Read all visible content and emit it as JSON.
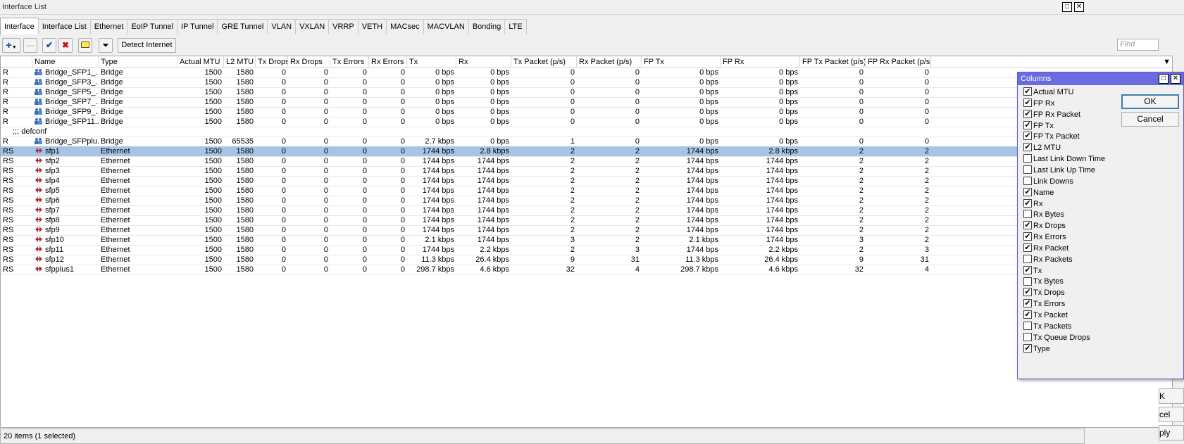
{
  "window": {
    "title": "Interface List"
  },
  "tabs": [
    "Interface",
    "Interface List",
    "Ethernet",
    "EoIP Tunnel",
    "IP Tunnel",
    "GRE Tunnel",
    "VLAN",
    "VXLAN",
    "VRRP",
    "VETH",
    "MACsec",
    "MACVLAN",
    "Bonding",
    "LTE"
  ],
  "active_tab": "Interface",
  "toolbar": {
    "detect_label": "Detect Internet",
    "find_placeholder": "Find"
  },
  "columns": [
    "",
    "Name",
    "Type",
    "Actual MTU",
    "L2 MTU",
    "Tx Drops",
    "Rx Drops",
    "Tx Errors",
    "Rx Errors",
    "Tx",
    "Rx",
    "Tx Packet (p/s)",
    "Rx Packet (p/s)",
    "FP Tx",
    "FP Rx",
    "FP Tx Packet (p/s)",
    "FP Rx Packet (p/s)"
  ],
  "rows": [
    {
      "flag": "R",
      "name": "Bridge_SFP1_...",
      "type": "Bridge",
      "amtu": "1500",
      "l2mtu": "1580",
      "txd": "0",
      "rxd": "0",
      "txe": "0",
      "rxe": "0",
      "tx": "0 bps",
      "rx": "0 bps",
      "txp": "0",
      "rxp": "0",
      "fptx": "0 bps",
      "fprx": "0 bps",
      "fptxp": "0",
      "fprxp": "0",
      "icon": "bridge-icon"
    },
    {
      "flag": "R",
      "name": "Bridge_SFP3_...",
      "type": "Bridge",
      "amtu": "1500",
      "l2mtu": "1580",
      "txd": "0",
      "rxd": "0",
      "txe": "0",
      "rxe": "0",
      "tx": "0 bps",
      "rx": "0 bps",
      "txp": "0",
      "rxp": "0",
      "fptx": "0 bps",
      "fprx": "0 bps",
      "fptxp": "0",
      "fprxp": "0",
      "icon": "bridge-icon"
    },
    {
      "flag": "R",
      "name": "Bridge_SFP5_...",
      "type": "Bridge",
      "amtu": "1500",
      "l2mtu": "1580",
      "txd": "0",
      "rxd": "0",
      "txe": "0",
      "rxe": "0",
      "tx": "0 bps",
      "rx": "0 bps",
      "txp": "0",
      "rxp": "0",
      "fptx": "0 bps",
      "fprx": "0 bps",
      "fptxp": "0",
      "fprxp": "0",
      "icon": "bridge-icon"
    },
    {
      "flag": "R",
      "name": "Bridge_SFP7_...",
      "type": "Bridge",
      "amtu": "1500",
      "l2mtu": "1580",
      "txd": "0",
      "rxd": "0",
      "txe": "0",
      "rxe": "0",
      "tx": "0 bps",
      "rx": "0 bps",
      "txp": "0",
      "rxp": "0",
      "fptx": "0 bps",
      "fprx": "0 bps",
      "fptxp": "0",
      "fprxp": "0",
      "icon": "bridge-icon"
    },
    {
      "flag": "R",
      "name": "Bridge_SFP9_...",
      "type": "Bridge",
      "amtu": "1500",
      "l2mtu": "1580",
      "txd": "0",
      "rxd": "0",
      "txe": "0",
      "rxe": "0",
      "tx": "0 bps",
      "rx": "0 bps",
      "txp": "0",
      "rxp": "0",
      "fptx": "0 bps",
      "fprx": "0 bps",
      "fptxp": "0",
      "fprxp": "0",
      "icon": "bridge-icon"
    },
    {
      "flag": "R",
      "name": "Bridge_SFP11...",
      "type": "Bridge",
      "amtu": "1500",
      "l2mtu": "1580",
      "txd": "0",
      "rxd": "0",
      "txe": "0",
      "rxe": "0",
      "tx": "0 bps",
      "rx": "0 bps",
      "txp": "0",
      "rxp": "0",
      "fptx": "0 bps",
      "fprx": "0 bps",
      "fptxp": "0",
      "fprxp": "0",
      "icon": "bridge-icon"
    },
    {
      "comment": ";;; defconf"
    },
    {
      "flag": "R",
      "name": "Bridge_SFPplu...",
      "type": "Bridge",
      "amtu": "1500",
      "l2mtu": "65535",
      "txd": "0",
      "rxd": "0",
      "txe": "0",
      "rxe": "0",
      "tx": "2.7 kbps",
      "rx": "0 bps",
      "txp": "1",
      "rxp": "0",
      "fptx": "0 bps",
      "fprx": "0 bps",
      "fptxp": "0",
      "fprxp": "0",
      "icon": "bridge-icon"
    },
    {
      "flag": "RS",
      "name": "sfp1",
      "type": "Ethernet",
      "amtu": "1500",
      "l2mtu": "1580",
      "txd": "0",
      "rxd": "0",
      "txe": "0",
      "rxe": "0",
      "tx": "1744 bps",
      "rx": "2.8 kbps",
      "txp": "2",
      "rxp": "2",
      "fptx": "1744 bps",
      "fprx": "2.8 kbps",
      "fptxp": "2",
      "fprxp": "2",
      "icon": "ethernet-icon",
      "selected": true
    },
    {
      "flag": "RS",
      "name": "sfp2",
      "type": "Ethernet",
      "amtu": "1500",
      "l2mtu": "1580",
      "txd": "0",
      "rxd": "0",
      "txe": "0",
      "rxe": "0",
      "tx": "1744 bps",
      "rx": "1744 bps",
      "txp": "2",
      "rxp": "2",
      "fptx": "1744 bps",
      "fprx": "1744 bps",
      "fptxp": "2",
      "fprxp": "2",
      "icon": "ethernet-icon"
    },
    {
      "flag": "RS",
      "name": "sfp3",
      "type": "Ethernet",
      "amtu": "1500",
      "l2mtu": "1580",
      "txd": "0",
      "rxd": "0",
      "txe": "0",
      "rxe": "0",
      "tx": "1744 bps",
      "rx": "1744 bps",
      "txp": "2",
      "rxp": "2",
      "fptx": "1744 bps",
      "fprx": "1744 bps",
      "fptxp": "2",
      "fprxp": "2",
      "icon": "ethernet-icon"
    },
    {
      "flag": "RS",
      "name": "sfp4",
      "type": "Ethernet",
      "amtu": "1500",
      "l2mtu": "1580",
      "txd": "0",
      "rxd": "0",
      "txe": "0",
      "rxe": "0",
      "tx": "1744 bps",
      "rx": "1744 bps",
      "txp": "2",
      "rxp": "2",
      "fptx": "1744 bps",
      "fprx": "1744 bps",
      "fptxp": "2",
      "fprxp": "2",
      "icon": "ethernet-icon"
    },
    {
      "flag": "RS",
      "name": "sfp5",
      "type": "Ethernet",
      "amtu": "1500",
      "l2mtu": "1580",
      "txd": "0",
      "rxd": "0",
      "txe": "0",
      "rxe": "0",
      "tx": "1744 bps",
      "rx": "1744 bps",
      "txp": "2",
      "rxp": "2",
      "fptx": "1744 bps",
      "fprx": "1744 bps",
      "fptxp": "2",
      "fprxp": "2",
      "icon": "ethernet-icon"
    },
    {
      "flag": "RS",
      "name": "sfp6",
      "type": "Ethernet",
      "amtu": "1500",
      "l2mtu": "1580",
      "txd": "0",
      "rxd": "0",
      "txe": "0",
      "rxe": "0",
      "tx": "1744 bps",
      "rx": "1744 bps",
      "txp": "2",
      "rxp": "2",
      "fptx": "1744 bps",
      "fprx": "1744 bps",
      "fptxp": "2",
      "fprxp": "2",
      "icon": "ethernet-icon"
    },
    {
      "flag": "RS",
      "name": "sfp7",
      "type": "Ethernet",
      "amtu": "1500",
      "l2mtu": "1580",
      "txd": "0",
      "rxd": "0",
      "txe": "0",
      "rxe": "0",
      "tx": "1744 bps",
      "rx": "1744 bps",
      "txp": "2",
      "rxp": "2",
      "fptx": "1744 bps",
      "fprx": "1744 bps",
      "fptxp": "2",
      "fprxp": "2",
      "icon": "ethernet-icon"
    },
    {
      "flag": "RS",
      "name": "sfp8",
      "type": "Ethernet",
      "amtu": "1500",
      "l2mtu": "1580",
      "txd": "0",
      "rxd": "0",
      "txe": "0",
      "rxe": "0",
      "tx": "1744 bps",
      "rx": "1744 bps",
      "txp": "2",
      "rxp": "2",
      "fptx": "1744 bps",
      "fprx": "1744 bps",
      "fptxp": "2",
      "fprxp": "2",
      "icon": "ethernet-icon"
    },
    {
      "flag": "RS",
      "name": "sfp9",
      "type": "Ethernet",
      "amtu": "1500",
      "l2mtu": "1580",
      "txd": "0",
      "rxd": "0",
      "txe": "0",
      "rxe": "0",
      "tx": "1744 bps",
      "rx": "1744 bps",
      "txp": "2",
      "rxp": "2",
      "fptx": "1744 bps",
      "fprx": "1744 bps",
      "fptxp": "2",
      "fprxp": "2",
      "icon": "ethernet-icon"
    },
    {
      "flag": "RS",
      "name": "sfp10",
      "type": "Ethernet",
      "amtu": "1500",
      "l2mtu": "1580",
      "txd": "0",
      "rxd": "0",
      "txe": "0",
      "rxe": "0",
      "tx": "2.1 kbps",
      "rx": "1744 bps",
      "txp": "3",
      "rxp": "2",
      "fptx": "2.1 kbps",
      "fprx": "1744 bps",
      "fptxp": "3",
      "fprxp": "2",
      "icon": "ethernet-icon"
    },
    {
      "flag": "RS",
      "name": "sfp11",
      "type": "Ethernet",
      "amtu": "1500",
      "l2mtu": "1580",
      "txd": "0",
      "rxd": "0",
      "txe": "0",
      "rxe": "0",
      "tx": "1744 bps",
      "rx": "2.2 kbps",
      "txp": "2",
      "rxp": "3",
      "fptx": "1744 bps",
      "fprx": "2.2 kbps",
      "fptxp": "2",
      "fprxp": "3",
      "icon": "ethernet-icon"
    },
    {
      "flag": "RS",
      "name": "sfp12",
      "type": "Ethernet",
      "amtu": "1500",
      "l2mtu": "1580",
      "txd": "0",
      "rxd": "0",
      "txe": "0",
      "rxe": "0",
      "tx": "11.3 kbps",
      "rx": "26.4 kbps",
      "txp": "9",
      "rxp": "31",
      "fptx": "11.3 kbps",
      "fprx": "26.4 kbps",
      "fptxp": "9",
      "fprxp": "31",
      "icon": "ethernet-icon"
    },
    {
      "flag": "RS",
      "name": "sfpplus1",
      "type": "Ethernet",
      "amtu": "1500",
      "l2mtu": "1580",
      "txd": "0",
      "rxd": "0",
      "txe": "0",
      "rxe": "0",
      "tx": "298.7 kbps",
      "rx": "4.6 kbps",
      "txp": "32",
      "rxp": "4",
      "fptx": "298.7 kbps",
      "fprx": "4.6 kbps",
      "fptxp": "32",
      "fprxp": "4",
      "icon": "ethernet-icon"
    }
  ],
  "status": {
    "text": "20 items (1 selected)"
  },
  "columns_dialog": {
    "title": "Columns",
    "ok_label": "OK",
    "cancel_label": "Cancel",
    "items": [
      {
        "label": "Actual MTU",
        "checked": true
      },
      {
        "label": "FP Rx",
        "checked": true
      },
      {
        "label": "FP Rx Packet",
        "checked": true
      },
      {
        "label": "FP Tx",
        "checked": true
      },
      {
        "label": "FP Tx Packet",
        "checked": true
      },
      {
        "label": "L2 MTU",
        "checked": true
      },
      {
        "label": "Last Link Down Time",
        "checked": false
      },
      {
        "label": "Last Link Up Time",
        "checked": false
      },
      {
        "label": "Link Downs",
        "checked": false
      },
      {
        "label": "Name",
        "checked": true
      },
      {
        "label": "Rx",
        "checked": true
      },
      {
        "label": "Rx Bytes",
        "checked": false
      },
      {
        "label": "Rx Drops",
        "checked": true
      },
      {
        "label": "Rx Errors",
        "checked": true
      },
      {
        "label": "Rx Packet",
        "checked": true
      },
      {
        "label": "Rx Packets",
        "checked": false
      },
      {
        "label": "Tx",
        "checked": true
      },
      {
        "label": "Tx Bytes",
        "checked": false
      },
      {
        "label": "Tx Drops",
        "checked": true
      },
      {
        "label": "Tx Errors",
        "checked": true
      },
      {
        "label": "Tx Packet",
        "checked": true
      },
      {
        "label": "Tx Packets",
        "checked": false
      },
      {
        "label": "Tx Queue Drops",
        "checked": false
      },
      {
        "label": "Type",
        "checked": true
      }
    ]
  },
  "background_buttons": [
    "K",
    "cel",
    "ply"
  ],
  "colors": {
    "selected_row": "#a7c4e6",
    "dialog_title": "#6b6be0",
    "add": "#1a3fa8",
    "remove_red": "#cc1111",
    "check_blue": "#1a3fa8"
  }
}
